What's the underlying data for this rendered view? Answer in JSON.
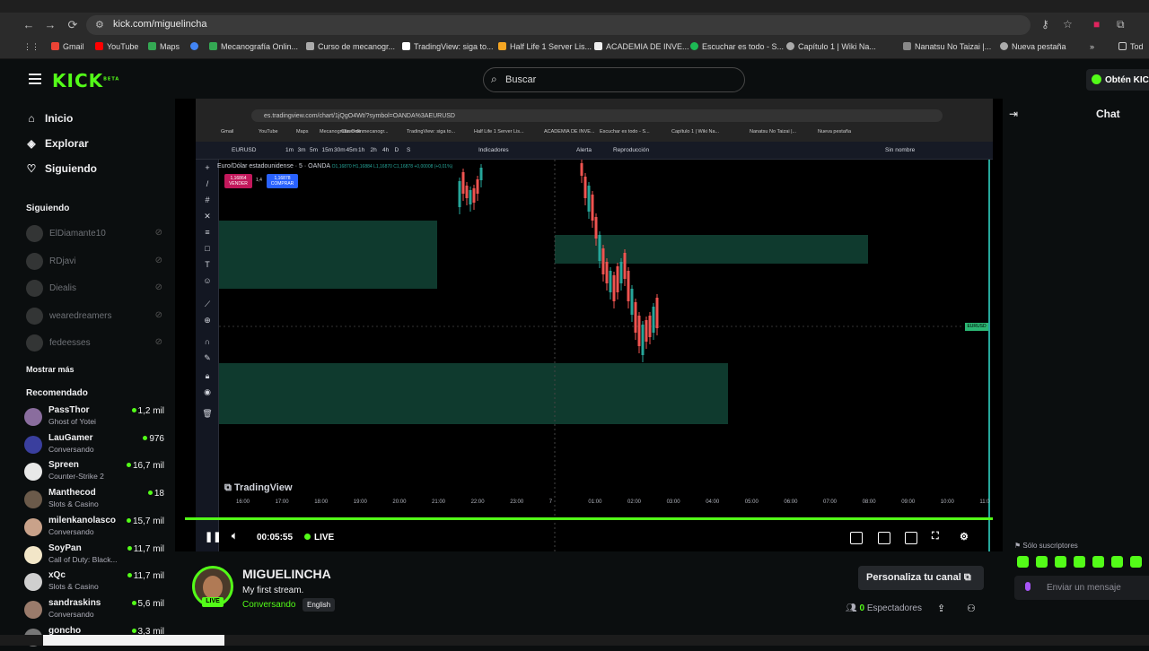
{
  "browser": {
    "url": "kick.com/miguelincha",
    "bookmarks": [
      "Gmail",
      "YouTube",
      "Maps",
      "Mecanografía Onlin...",
      "Curso de mecanogr...",
      "TradingView: siga to...",
      "Half Life 1 Server Lis...",
      "ACADEMIA DE INVE...",
      "Escuchar es todo - S...",
      "Capítulo 1 | Wiki Na...",
      "Nanatsu No Taizai |...",
      "Nueva pestaña"
    ],
    "bookmarks_folder": "Tod"
  },
  "header": {
    "logo": "KICK",
    "logo_sup": "BETA",
    "search_placeholder": "Buscar",
    "get_kick": "Obtén KICK"
  },
  "sidebar": {
    "nav": [
      {
        "label": "Inicio",
        "icon": "home-icon"
      },
      {
        "label": "Explorar",
        "icon": "compass-icon"
      },
      {
        "label": "Siguiendo",
        "icon": "heart-icon"
      }
    ],
    "following_title": "Siguiendo",
    "following": [
      "ElDiamante10",
      "RDjavi",
      "Diealis",
      "wearedreamers",
      "fedeesses"
    ],
    "show_more": "Mostrar más",
    "recommended_title": "Recomendado",
    "recommended": [
      {
        "name": "PassThor",
        "category": "Ghost of Yotei",
        "viewers": "1,2 mil",
        "color": "#8a6d9e"
      },
      {
        "name": "LauGamer",
        "category": "Conversando",
        "viewers": "976",
        "color": "#3a3f9e"
      },
      {
        "name": "Spreen",
        "category": "Counter-Strike 2",
        "viewers": "16,7 mil",
        "color": "#e8e8e8"
      },
      {
        "name": "Manthecod",
        "category": "Slots & Casino",
        "viewers": "18",
        "color": "#6b5a4a"
      },
      {
        "name": "milenkanolasco",
        "category": "Conversando",
        "viewers": "15,7 mil",
        "color": "#c9a28a"
      },
      {
        "name": "SoyPan",
        "category": "Call of Duty: Black...",
        "viewers": "11,7 mil",
        "color": "#f2e6c8"
      },
      {
        "name": "xQc",
        "category": "Slots & Casino",
        "viewers": "11,7 mil",
        "color": "#cfcfcf"
      },
      {
        "name": "sandraskins",
        "category": "Conversando",
        "viewers": "5,6 mil",
        "color": "#9a7b6b"
      },
      {
        "name": "goncho",
        "category": "",
        "viewers": "3,3 mil",
        "color": "#777777"
      }
    ]
  },
  "tradingview": {
    "url": "es.tradingview.com/chart/1jQgO4Wt/?symbol=OANDA%3AEURUSD",
    "bookmarks": [
      "Gmail",
      "YouTube",
      "Maps",
      "Mecanografía Onlin...",
      "Curso de mecanogr...",
      "TradingView: siga to...",
      "Half Life 1 Server Lis...",
      "ACADEMIA DE INVE...",
      "Escuchar es todo - S...",
      "Capítulo 1 | Wiki Na...",
      "Nanatsu No Taizai |...",
      "Nueva pestaña"
    ],
    "symbol": "EURUSD",
    "intervals": [
      "1m",
      "3m",
      "5m",
      "15m",
      "30m",
      "45m",
      "1h",
      "2h",
      "4h",
      "D",
      "S"
    ],
    "indicators": "Indicadores",
    "alert": "Alerta",
    "replay": "Reproducción",
    "unnamed": "Sin nombre",
    "title": "Euro/Dólar estadounidense · 5 · OANDA",
    "ohlc": "O1,16870 H1,16884 L1,16870 C1,16878 +0,00008 (+0,01%)",
    "sell": {
      "price": "1,16864",
      "label": "VENDER"
    },
    "buy": {
      "price": "1,16878",
      "label": "COMPRAR"
    },
    "spread": "1,4",
    "pricetag": "EURUSD",
    "logo": "TradingView",
    "time_labels": [
      "16:00",
      "17:00",
      "18:00",
      "19:00",
      "20:00",
      "21:00",
      "22:00",
      "23:00",
      "7",
      "01:00",
      "02:00",
      "03:00",
      "04:00",
      "05:00",
      "06:00",
      "07:00",
      "08:00",
      "09:00",
      "10:00",
      "11:0"
    ]
  },
  "player": {
    "time": "00:05:55",
    "live": "LIVE"
  },
  "stream": {
    "channel": "MIGUELINCHA",
    "title": "My first stream.",
    "category": "Conversando",
    "language": "English",
    "live_badge": "LIVE",
    "customize": "Personaliza tu canal",
    "viewers_count": "0",
    "viewers_label": "Espectadores"
  },
  "chat": {
    "title": "Chat",
    "subs_only": "Sólo suscriptores",
    "placeholder": "Enviar un mensaje"
  },
  "colors": {
    "accent": "#53fc18",
    "bg": "#0b0e0f",
    "zone": "#0f3a2e",
    "bull": "#26a69a",
    "bear": "#ef5350"
  }
}
